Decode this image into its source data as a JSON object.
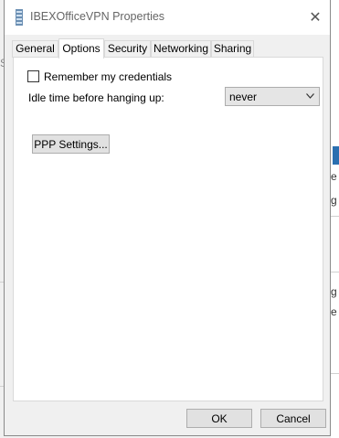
{
  "window": {
    "title": "IBEXOfficeVPN Properties",
    "close_symbol": "✕"
  },
  "tabs": [
    {
      "label": "General",
      "active": false
    },
    {
      "label": "Options",
      "active": true
    },
    {
      "label": "Security",
      "active": false
    },
    {
      "label": "Networking",
      "active": false
    },
    {
      "label": "Sharing",
      "active": false
    }
  ],
  "options": {
    "remember_credentials_label": "Remember my credentials",
    "remember_credentials_checked": false,
    "idle_time_label": "Idle time before hanging up:",
    "idle_time_value": "never",
    "ppp_button_label": "PPP Settings..."
  },
  "footer": {
    "ok_label": "OK",
    "cancel_label": "Cancel"
  },
  "icons": {
    "title_icon": "network-connection-icon",
    "dropdown_icon": "chevron-down-icon"
  },
  "background": {
    "right_fragments": [
      "e",
      "g",
      "g",
      "e"
    ],
    "left_fragment": "S"
  }
}
